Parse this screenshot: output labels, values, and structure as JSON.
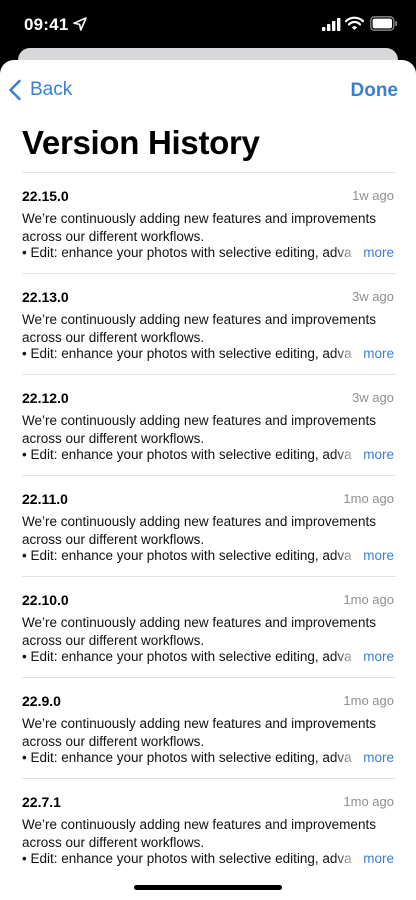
{
  "status_bar": {
    "time": "09:41"
  },
  "nav": {
    "back_label": "Back",
    "done_label": "Done"
  },
  "page": {
    "title": "Version History"
  },
  "versions": [
    {
      "version": "22.15.0",
      "date": "1w ago",
      "description": "We’re continuously adding new features and improvements across our different workflows.",
      "bullet": "• Edit: enhance your photos with selective editing, adva",
      "more": "more"
    },
    {
      "version": "22.13.0",
      "date": "3w ago",
      "description": "We’re continuously adding new features and improvements across our different workflows.",
      "bullet": "• Edit: enhance your photos with selective editing, adva",
      "more": "more"
    },
    {
      "version": "22.12.0",
      "date": "3w ago",
      "description": "We’re continuously adding new features and improvements across our different workflows.",
      "bullet": "• Edit: enhance your photos with selective editing, adva",
      "more": "more"
    },
    {
      "version": "22.11.0",
      "date": "1mo ago",
      "description": "We’re continuously adding new features and improvements across our different workflows.",
      "bullet": "• Edit: enhance your photos with selective editing, adva",
      "more": "more"
    },
    {
      "version": "22.10.0",
      "date": "1mo ago",
      "description": "We’re continuously adding new features and improvements across our different workflows.",
      "bullet": "• Edit: enhance your photos with selective editing, adva",
      "more": "more"
    },
    {
      "version": "22.9.0",
      "date": "1mo ago",
      "description": "We’re continuously adding new features and improvements across our different workflows.",
      "bullet": "• Edit: enhance your photos with selective editing, adva",
      "more": "more"
    },
    {
      "version": "22.7.1",
      "date": "1mo ago",
      "description": "We’re continuously adding new features and improvements across our different workflows.",
      "bullet": "• Edit: enhance your photos with selective editing, adva",
      "more": "more"
    }
  ],
  "colors": {
    "accent": "#3b7fd1",
    "secondary_text": "#8e8e93",
    "separator": "#e3e3e6"
  },
  "icons": {
    "location": "location-arrow-icon",
    "signal": "cellular-signal-icon",
    "wifi": "wifi-icon",
    "battery": "battery-icon",
    "back": "chevron-left-icon"
  }
}
